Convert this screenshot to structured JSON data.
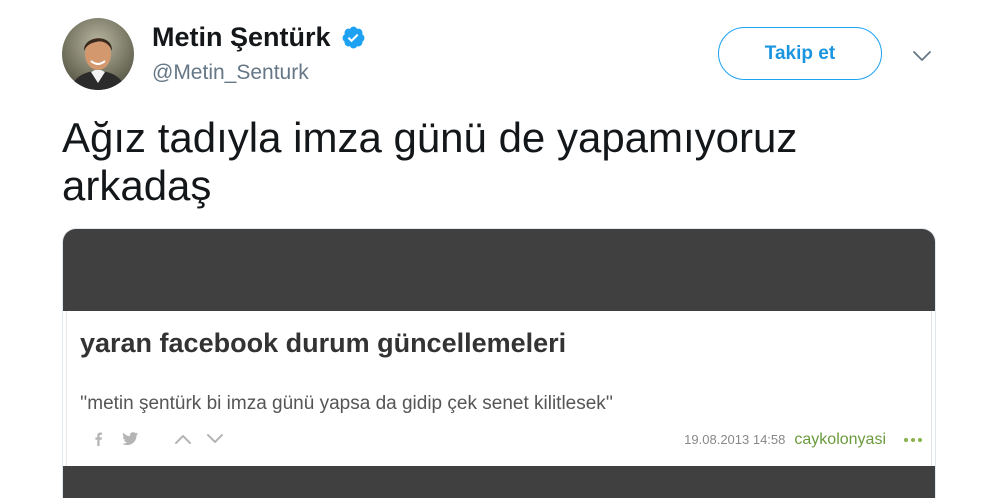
{
  "header": {
    "avatar_icon": "avatar-photo",
    "name": "Metin Şentürk",
    "verified_icon": "verified-badge-icon",
    "handle": "@Metin_Senturk",
    "follow_button": "Takip et",
    "menu_icon": "chevron-down-icon"
  },
  "tweet_text": "Ağız tadıyla imza günü de yapamıyoruz arkadaş",
  "embed": {
    "title": "yaran facebook durum güncellemeleri",
    "quote": "''metin şentürk bi imza günü yapsa da gidip çek senet kilitlesek''",
    "share_icons": [
      "facebook-icon",
      "twitter-icon"
    ],
    "vote_icons": [
      "chevron-up-icon",
      "chevron-down-icon"
    ],
    "date": "19.08.2013 14:58",
    "author": "caykolonyasi",
    "more_icon": "more-dots-icon"
  },
  "colors": {
    "accent": "#1da1f2",
    "accent_text": "#1b95e0",
    "text": "#14171a",
    "muted": "#657786",
    "embed_band": "#404040",
    "embed_author": "#6b9a3d",
    "embed_dots": "#86b34a",
    "embed_icon": "#b5b5b5"
  }
}
